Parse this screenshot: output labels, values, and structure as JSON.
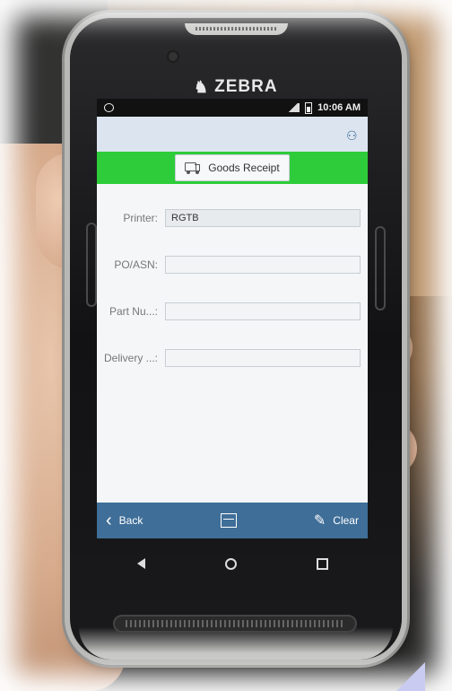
{
  "device": {
    "brand": "ZEBRA"
  },
  "status_bar": {
    "time": "10:06 AM"
  },
  "app": {
    "title": "Goods Receipt",
    "fields": [
      {
        "label": "Printer:",
        "value": "RGTB",
        "placeholder": ""
      },
      {
        "label": "PO/ASN:",
        "value": "",
        "placeholder": ""
      },
      {
        "label": "Part Nu...:",
        "value": "",
        "placeholder": ""
      },
      {
        "label": "Delivery ...:",
        "value": "",
        "placeholder": ""
      }
    ],
    "footer": {
      "back_label": "Back",
      "clear_label": "Clear"
    }
  },
  "colors": {
    "title_bar": "#2ecc3a",
    "footer_bar": "#3f6e98",
    "app_bar": "#dce5ef"
  }
}
